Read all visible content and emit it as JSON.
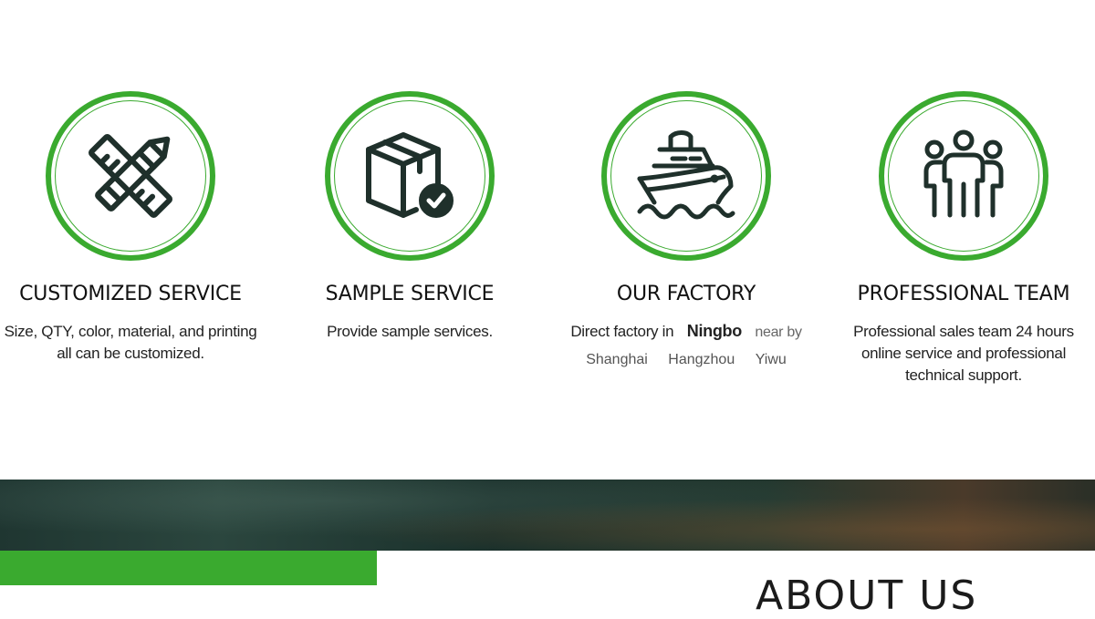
{
  "features": [
    {
      "title": "CUSTOMIZED SERVICE",
      "icon": "pencil-ruler-icon",
      "desc_lines": [
        "Size, QTY, color, material, and printing",
        "all can be customized."
      ]
    },
    {
      "title": "SAMPLE SERVICE",
      "icon": "package-check-icon",
      "desc_lines": [
        "Provide sample services."
      ]
    },
    {
      "title": "OUR FACTORY",
      "icon": "ship-icon",
      "factory": {
        "prefix": "Direct factory in",
        "main_city": "Ningbo",
        "near": "near by",
        "cities": [
          "Shanghai",
          "Hangzhou",
          "Yiwu"
        ]
      }
    },
    {
      "title": "PROFESSIONAL TEAM",
      "icon": "team-icon",
      "desc_lines": [
        "Professional sales team 24 hours",
        "online service and professional",
        "technical support."
      ]
    }
  ],
  "bottom": {
    "heading": "ABOUT US"
  },
  "colors": {
    "accent": "#3aaa2f",
    "icon": "#1f302b"
  }
}
